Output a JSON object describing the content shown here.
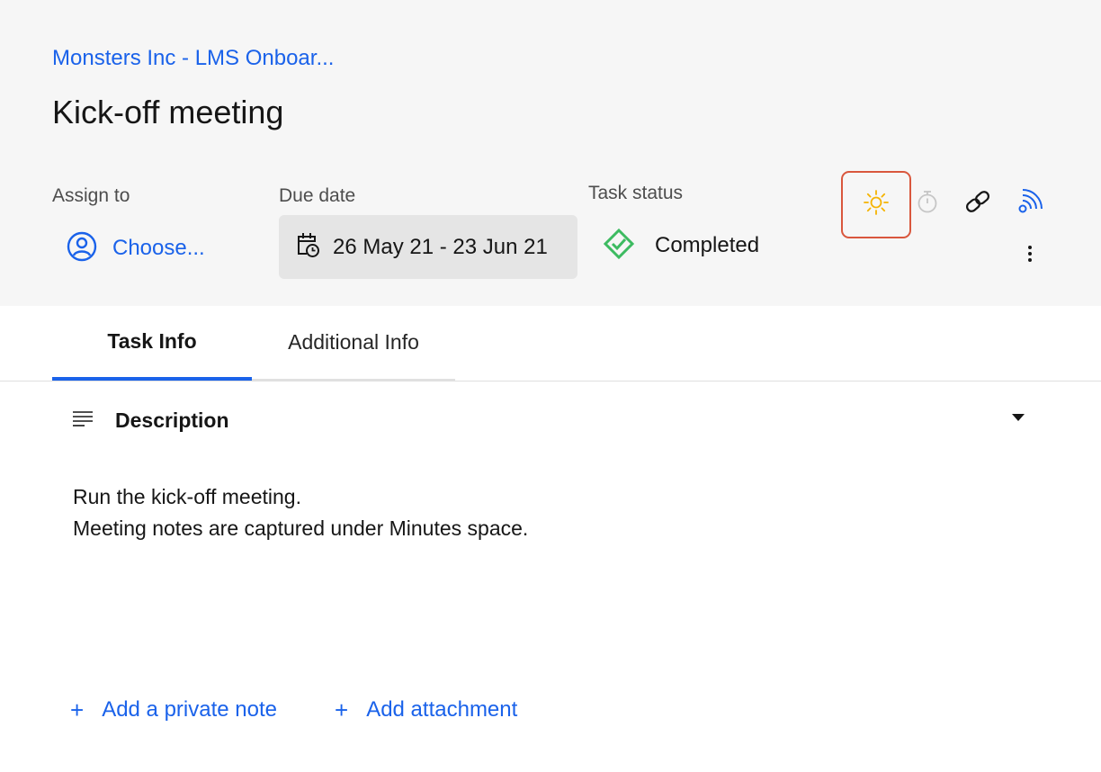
{
  "breadcrumb": "Monsters Inc - LMS Onboar...",
  "title": "Kick-off meeting",
  "fields": {
    "assign_label": "Assign to",
    "assign_value": "Choose...",
    "due_label": "Due date",
    "due_value": "26 May 21 - 23 Jun 21",
    "status_label": "Task status",
    "status_value": "Completed"
  },
  "toolbar_icons": [
    "sun-icon",
    "timer-icon",
    "link-icon",
    "feed-icon",
    "more-vertical-icon"
  ],
  "tabs": [
    {
      "label": "Task Info",
      "active": true
    },
    {
      "label": "Additional Info",
      "active": false
    }
  ],
  "description": {
    "heading": "Description",
    "lines": [
      "Run the kick-off meeting.",
      "Meeting notes are captured under Minutes space."
    ]
  },
  "actions": {
    "note_label": "Add a private note",
    "attach_label": "Add attachment",
    "plus": "+"
  },
  "colors": {
    "accent": "#1a62ea",
    "status_green": "#3dbb61",
    "sun_yellow": "#f5b301",
    "highlight_red": "#d9573d",
    "header_bg": "#f6f6f6"
  }
}
